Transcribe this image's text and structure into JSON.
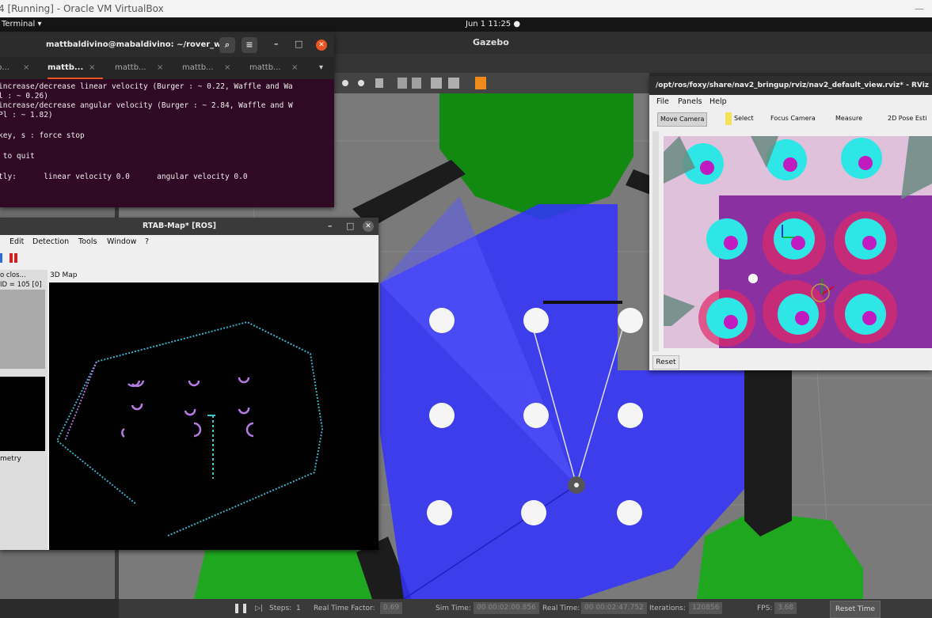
{
  "vbox": {
    "title": "4 [Running] - Oracle VM VirtualBox",
    "minimize": "—"
  },
  "topbar": {
    "app_menu": "Terminal ▾",
    "clock": "Jun 1  11:25  ●"
  },
  "gazebo": {
    "title": "Gazebo",
    "bottom": {
      "steps_label": "Steps:",
      "steps_value": "1",
      "rtf_label": "Real Time Factor:",
      "rtf_value": "0.69",
      "sim_time_label": "Sim Time:",
      "sim_time_value": "00 00:02:00.856",
      "real_time_label": "Real Time:",
      "real_time_value": "00 00:02:47.752",
      "iterations_label": "Iterations:",
      "iterations_value": "120856",
      "fps_label": "FPS:",
      "fps_value": "3.68",
      "reset_label": "Reset Time"
    }
  },
  "terminal": {
    "title": "mattbaldivino@mabaldivino: ~/rover_ws",
    "tabs": [
      "b...",
      "mattb...",
      "mattb...",
      "mattb...",
      "mattb..."
    ],
    "lines": [
      "increase/decrease linear velocity (Burger : ~ 0.22, Waffle and Wa",
      "l : ~ 0.26)",
      "increase/decrease angular velocity (Burger : ~ 2.84, Waffle and W",
      "Pl : ~ 1.82)",
      "",
      "key, s : force stop",
      "",
      " to quit",
      "",
      "tly:      linear velocity 0.0      angular velocity 0.0"
    ]
  },
  "rtab": {
    "title": "RTAB-Map* [ROS]",
    "menu": [
      "Edit",
      "Detection",
      "Tools",
      "Window",
      "?"
    ],
    "left_panel_title": "o clos...",
    "left_panel_id": "ID = 105 [0]",
    "odometry_label": "metry",
    "map_label": "3D Map"
  },
  "rviz": {
    "title": "/opt/ros/foxy/share/nav2_bringup/rviz/nav2_default_view.rviz* - RViz",
    "menu": [
      "File",
      "Panels",
      "Help"
    ],
    "tools": [
      "Move Camera",
      "Select",
      "Focus Camera",
      "Measure",
      "2D Pose Esti"
    ],
    "reset": "Reset"
  },
  "colors": {
    "gazebo_floor": "#7a7a7a",
    "laser": "#3333ff",
    "green_obstacle": "#128a12",
    "terminal_bg": "#300a24",
    "ubuntu_orange": "#e95420",
    "rviz_cyan": "#2ee6e6",
    "rviz_magenta": "#c01ac0"
  }
}
